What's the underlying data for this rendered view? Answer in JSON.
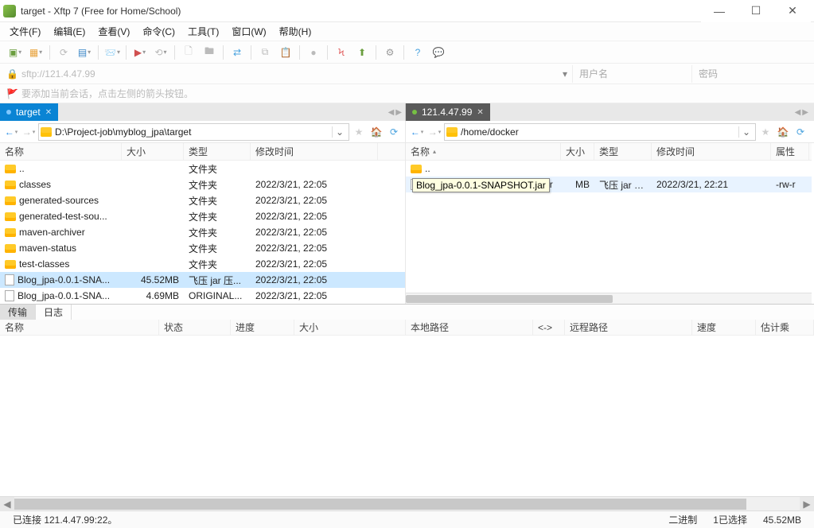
{
  "window": {
    "title": "target - Xftp 7 (Free for Home/School)"
  },
  "menu": [
    "文件(F)",
    "编辑(E)",
    "查看(V)",
    "命令(C)",
    "工具(T)",
    "窗口(W)",
    "帮助(H)"
  ],
  "address": {
    "url": "sftp://121.4.47.99",
    "user_placeholder": "用户名",
    "pass_placeholder": "密码"
  },
  "hint": "要添加当前会话，点击左侧的箭头按钮。",
  "tabs": {
    "left": {
      "label": "target"
    },
    "right": {
      "label": "121.4.47.99"
    }
  },
  "panes": {
    "left": {
      "path": "D:\\Project-job\\myblog_jpa\\target",
      "columns": {
        "name": "名称",
        "size": "大小",
        "type": "类型",
        "mod": "修改时间"
      },
      "rows": [
        {
          "icon": "folder",
          "name": "..",
          "size": "",
          "type": "文件夹",
          "mod": ""
        },
        {
          "icon": "folder",
          "name": "classes",
          "size": "",
          "type": "文件夹",
          "mod": "2022/3/21, 22:05"
        },
        {
          "icon": "folder",
          "name": "generated-sources",
          "size": "",
          "type": "文件夹",
          "mod": "2022/3/21, 22:05"
        },
        {
          "icon": "folder",
          "name": "generated-test-sou...",
          "size": "",
          "type": "文件夹",
          "mod": "2022/3/21, 22:05"
        },
        {
          "icon": "folder",
          "name": "maven-archiver",
          "size": "",
          "type": "文件夹",
          "mod": "2022/3/21, 22:05"
        },
        {
          "icon": "folder",
          "name": "maven-status",
          "size": "",
          "type": "文件夹",
          "mod": "2022/3/21, 22:05"
        },
        {
          "icon": "folder",
          "name": "test-classes",
          "size": "",
          "type": "文件夹",
          "mod": "2022/3/21, 22:05"
        },
        {
          "icon": "file",
          "name": "Blog_jpa-0.0.1-SNA...",
          "size": "45.52MB",
          "type": "飞压 jar 压...",
          "mod": "2022/3/21, 22:05",
          "selected": true
        },
        {
          "icon": "file",
          "name": "Blog_jpa-0.0.1-SNA...",
          "size": "4.69MB",
          "type": "ORIGINAL...",
          "mod": "2022/3/21, 22:05"
        }
      ]
    },
    "right": {
      "path": "/home/docker",
      "columns": {
        "name": "名称",
        "size": "大小",
        "type": "类型",
        "mod": "修改时间",
        "attr": "属性"
      },
      "rows": [
        {
          "icon": "folder",
          "name": "..",
          "size": "",
          "type": "",
          "mod": "",
          "attr": ""
        },
        {
          "icon": "file",
          "name": "Blog_jpa-0.0.1-SNAPSHOT.jar",
          "size": "MB",
          "type": "飞压 jar 压...",
          "mod": "2022/3/21, 22:21",
          "attr": "-rw-r",
          "hover": true
        }
      ],
      "tooltip": "Blog_jpa-0.0.1-SNAPSHOT.jar"
    }
  },
  "bottomtabs": {
    "transfer": "传输",
    "log": "日志"
  },
  "transfercols": {
    "name": "名称",
    "status": "状态",
    "progress": "进度",
    "size": "大小",
    "local": "本地路径",
    "dir": "<->",
    "remote": "远程路径",
    "speed": "速度",
    "est": "估计乘"
  },
  "status": {
    "conn": "已连接 121.4.47.99:22。",
    "binary": "二进制",
    "sel": "1已选择",
    "size": "45.52MB"
  }
}
